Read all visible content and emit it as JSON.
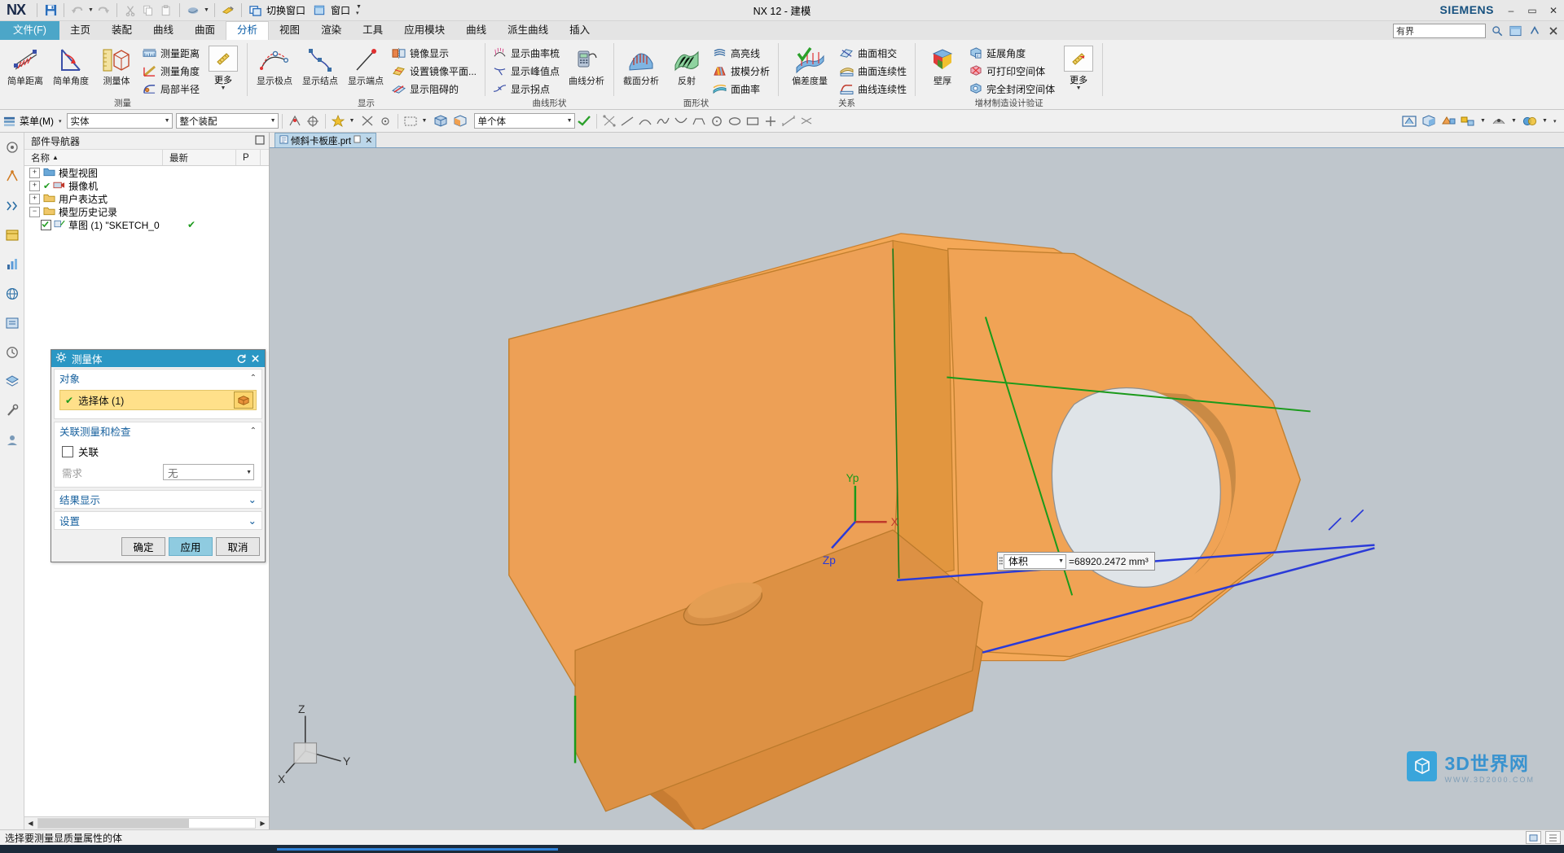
{
  "window": {
    "app_name": "NX",
    "title": "NX 12 - 建模",
    "brand": "SIEMENS",
    "minimize": "–",
    "maximize": "▭",
    "close": "✕"
  },
  "quick_access": {
    "items": [
      {
        "name": "save-icon",
        "label": ""
      },
      {
        "name": "undo-icon",
        "label": ""
      },
      {
        "name": "undo-dropdown-icon",
        "label": ""
      },
      {
        "name": "redo-icon",
        "label": ""
      },
      {
        "name": "cut-icon",
        "label": ""
      },
      {
        "name": "copy-icon",
        "label": ""
      },
      {
        "name": "paste-icon",
        "label": ""
      },
      {
        "name": "print-icon",
        "label": ""
      },
      {
        "name": "print-dropdown-icon",
        "label": ""
      },
      {
        "name": "paint-icon",
        "label": ""
      }
    ],
    "switch_window": "切换窗口",
    "window_menu": "窗口"
  },
  "tabs": {
    "file": "文件(F)",
    "items": [
      "主页",
      "装配",
      "曲线",
      "曲面",
      "分析",
      "视图",
      "渲染",
      "工具",
      "应用模块",
      "曲线",
      "派生曲线",
      "插入"
    ],
    "active": "分析",
    "search_value": "有界",
    "right_icons": [
      "search-icon",
      "window-icon",
      "help-icon",
      "close-ribbon-icon"
    ]
  },
  "ribbon": {
    "groups": [
      {
        "label": "测量",
        "big": [
          {
            "name": "simple-distance",
            "label": "简单距离"
          },
          {
            "name": "simple-angle",
            "label": "简单角度"
          },
          {
            "name": "measure-body",
            "label": "测量体"
          }
        ],
        "small": [
          {
            "name": "measure-distance",
            "label": "测量距离"
          },
          {
            "name": "measure-angle",
            "label": "测量角度"
          },
          {
            "name": "local-radius",
            "label": "局部半径"
          }
        ],
        "more": "更多"
      },
      {
        "label": "显示",
        "big": [
          {
            "name": "show-poles",
            "label": "显示极点"
          },
          {
            "name": "show-knots",
            "label": "显示结点"
          },
          {
            "name": "show-endpoints",
            "label": "显示端点"
          }
        ],
        "small": [
          {
            "name": "mirror-display",
            "label": "镜像显示"
          },
          {
            "name": "set-mirror-plane",
            "label": "设置镜像平面..."
          },
          {
            "name": "show-obstructed",
            "label": "显示阻碍的"
          }
        ],
        "more": ""
      },
      {
        "label": "曲线形状",
        "big": [
          {
            "name": "curve-analysis",
            "label": "曲线分析"
          }
        ],
        "small": [
          {
            "name": "show-curvature-comb",
            "label": "显示曲率梳"
          },
          {
            "name": "show-peak-points",
            "label": "显示峰值点"
          },
          {
            "name": "show-inflection-points",
            "label": "显示拐点"
          }
        ],
        "more": ""
      },
      {
        "label": "面形状",
        "big": [
          {
            "name": "section-analysis",
            "label": "截面分析"
          },
          {
            "name": "reflection",
            "label": "反射"
          }
        ],
        "small": [
          {
            "name": "highlight-lines",
            "label": "高亮线"
          },
          {
            "name": "draft-analysis",
            "label": "拔模分析"
          },
          {
            "name": "face-curvature",
            "label": "面曲率"
          }
        ],
        "more": ""
      },
      {
        "label": "关系",
        "big": [
          {
            "name": "deviation-gauge",
            "label": "偏差度量"
          }
        ],
        "small": [
          {
            "name": "surface-intersection",
            "label": "曲面相交"
          },
          {
            "name": "surface-continuity",
            "label": "曲面连续性"
          },
          {
            "name": "curve-continuity",
            "label": "曲线连续性"
          }
        ],
        "more": ""
      },
      {
        "label": "增材制造设计验证",
        "big": [
          {
            "name": "wall-thickness",
            "label": "壁厚"
          }
        ],
        "small": [
          {
            "name": "overhang-angle",
            "label": "延展角度"
          },
          {
            "name": "printable-volume",
            "label": "可打印空间体"
          },
          {
            "name": "fully-enclosed-volume",
            "label": "完全封闭空间体"
          }
        ],
        "more": "更多"
      }
    ]
  },
  "toolbar2": {
    "menu_label": "菜单(M)",
    "filter_type": "实体",
    "filter_scope": "整个装配",
    "selection_mode": "单个体"
  },
  "navigator": {
    "title": "部件导航器",
    "columns": [
      "名称",
      "最新",
      "P"
    ],
    "nodes": [
      {
        "label": "模型视图",
        "expander": "+",
        "depth": 0,
        "check": false
      },
      {
        "label": "摄像机",
        "expander": "+",
        "depth": 0,
        "check": true
      },
      {
        "label": "用户表达式",
        "expander": "+",
        "depth": 0,
        "check": false
      },
      {
        "label": "模型历史记录",
        "expander": "−",
        "depth": 0,
        "check": false
      },
      {
        "label": "草图 (1) \"SKETCH_0",
        "expander": "",
        "depth": 1,
        "check": true
      }
    ]
  },
  "dialog": {
    "title": "测量体",
    "header_icons": [
      "reset-icon",
      "close-icon"
    ],
    "sections": [
      {
        "name": "object",
        "title": "对象",
        "chevron": "⌃",
        "select_label": "选择体 (1)"
      },
      {
        "name": "associative-measure",
        "title": "关联测量和检查",
        "chevron": "⌃",
        "checkbox_label": "关联",
        "field_label": "需求",
        "field_value": "无"
      }
    ],
    "collapsed": [
      {
        "name": "result-display",
        "title": "结果显示",
        "chevron": "⌄"
      },
      {
        "name": "settings",
        "title": "设置",
        "chevron": "⌄"
      }
    ],
    "buttons": {
      "ok": "确定",
      "apply": "应用",
      "cancel": "取消"
    }
  },
  "graphics": {
    "file_tab": "倾斜卡板座.prt",
    "file_tab_close": "✕",
    "callout": {
      "measure_type": "体积",
      "value": "=68920.2472 mm³"
    },
    "triad_labels": {
      "x": "X",
      "y": "Yp",
      "z": "Zp"
    },
    "csys_labels": {
      "x": "X",
      "y": "Y",
      "z": "Z"
    },
    "model_color": "#f0a050",
    "background_color": "#bfc6cc"
  },
  "watermark": {
    "title": "3D世界网",
    "subtitle": "WWW.3D2000.COM"
  },
  "status": {
    "message": "选择要测量显质量属性的体"
  }
}
